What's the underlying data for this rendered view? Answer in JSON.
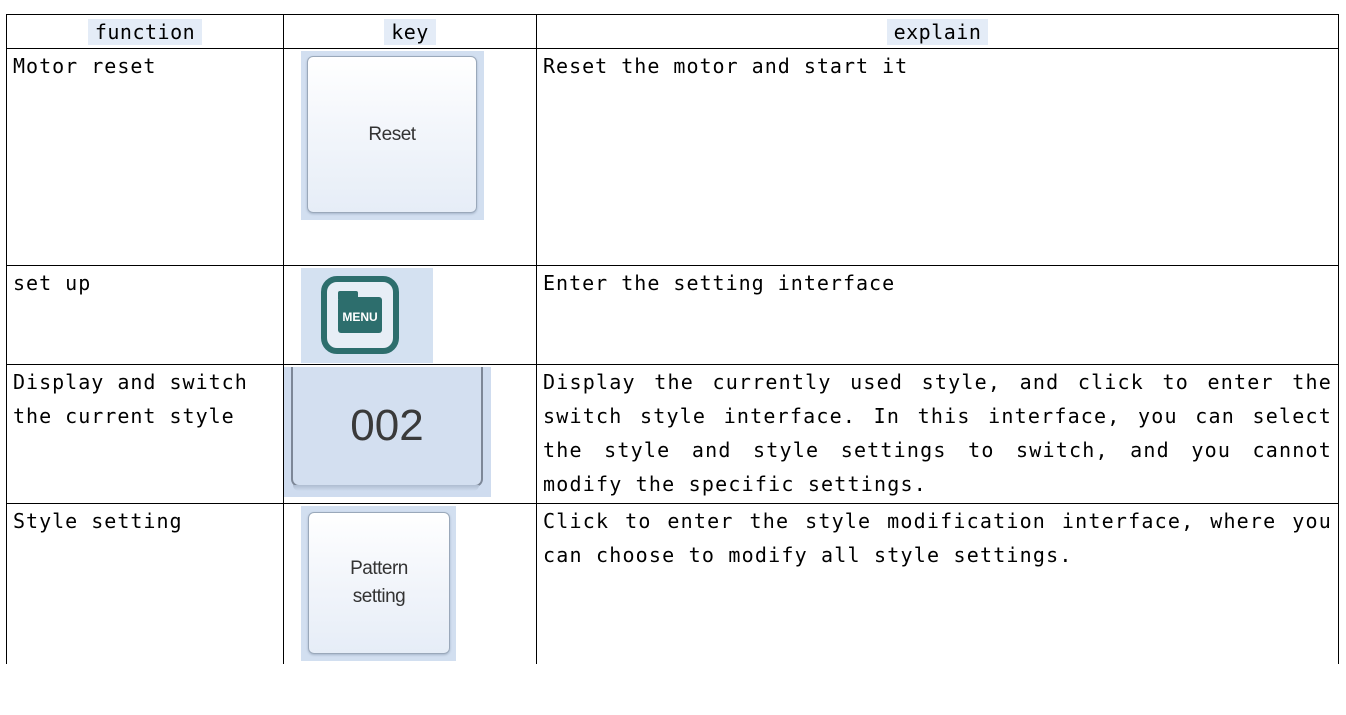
{
  "table": {
    "headers": [
      "function",
      "key",
      "explain"
    ],
    "rows": [
      {
        "function": "Motor reset",
        "key_label": "Reset",
        "explain": "Reset the motor and start it"
      },
      {
        "function": "set up",
        "key_label": "MENU",
        "explain": "Enter the setting interface"
      },
      {
        "function": "Display and switch the current style",
        "key_label": "002",
        "explain": "Display the currently used style, and click to enter the switch style interface. In this interface, you can select the style and style settings to switch, and you cannot modify the specific settings."
      },
      {
        "function": "Style setting",
        "key_label_line1": "Pattern",
        "key_label_line2": "setting",
        "explain": "Click to enter the style modification interface, where you can choose to modify all style settings."
      }
    ]
  },
  "colors": {
    "header_highlight": "#e4ecf7",
    "menu_icon": "#2d6e6d",
    "button_background": "#d2dff0"
  }
}
